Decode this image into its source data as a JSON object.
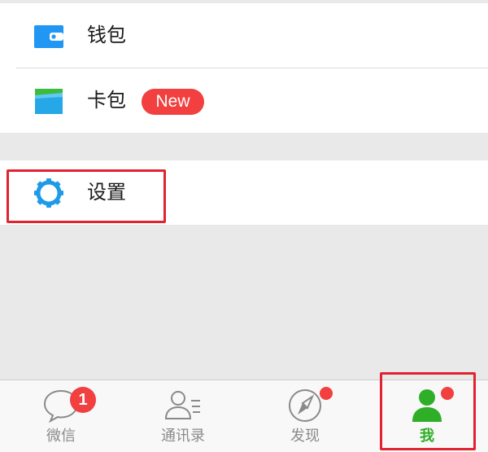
{
  "menu": {
    "wallet": {
      "label": "钱包",
      "icon": "wallet-icon",
      "icon_color": "#2196f3"
    },
    "card_bag": {
      "label": "卡包",
      "icon": "card-bag-icon",
      "badge": "New"
    },
    "settings": {
      "label": "设置",
      "icon": "gear-icon",
      "icon_color": "#1e9be8"
    }
  },
  "tabbar": {
    "tabs": [
      {
        "label": "微信",
        "icon": "chat-bubble-icon",
        "badge": "1"
      },
      {
        "label": "通讯录",
        "icon": "contacts-icon"
      },
      {
        "label": "发现",
        "icon": "compass-icon",
        "dot": true
      },
      {
        "label": "我",
        "icon": "person-icon",
        "dot": true,
        "active": true
      }
    ],
    "active_color": "#2fae27",
    "inactive_color": "#8a8a8a"
  },
  "colors": {
    "badge_red": "#f23f3f",
    "highlight_red": "#e0232f",
    "background": "#e9e9e9"
  }
}
